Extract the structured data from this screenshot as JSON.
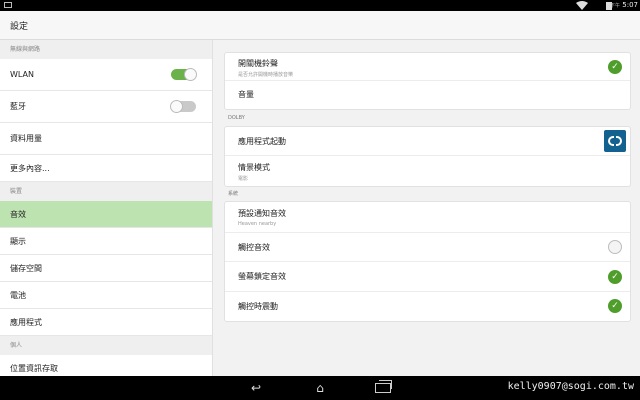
{
  "status_bar": {
    "ampm": "下午",
    "time": "5:07"
  },
  "app_title": "設定",
  "sidebar": {
    "sections": [
      {
        "header": "無線與網路",
        "items": [
          {
            "label": "WLAN",
            "toggle": "on"
          },
          {
            "label": "藍牙",
            "toggle": "off"
          },
          {
            "label": "資料用量"
          },
          {
            "label": "更多內容..."
          }
        ]
      },
      {
        "header": "裝置",
        "items": [
          {
            "label": "音效",
            "selected": true
          },
          {
            "label": "顯示"
          },
          {
            "label": "儲存空間"
          },
          {
            "label": "電池"
          },
          {
            "label": "應用程式"
          }
        ]
      },
      {
        "header": "個人",
        "items": [
          {
            "label": "位置資訊存取"
          }
        ]
      }
    ]
  },
  "sound": {
    "card1": [
      {
        "label": "開關機鈴聲",
        "sub": "是否允許開機時播放音樂",
        "control": "check"
      },
      {
        "label": "音量"
      }
    ],
    "dolby_header": "DOLBY",
    "card2": [
      {
        "label": "應用程式起動",
        "control": "dolby-icon"
      },
      {
        "label": "情景模式",
        "sub": "電影"
      }
    ],
    "system_header": "系統",
    "card3": [
      {
        "label": "預設通知音效",
        "sub": "Heaven nearby"
      },
      {
        "label": "觸控音效",
        "control": "empty"
      },
      {
        "label": "螢幕鎖定音效",
        "control": "check"
      },
      {
        "label": "觸控時震動",
        "control": "check"
      }
    ]
  },
  "navbar": {
    "back": "↩",
    "home": "⌂"
  },
  "watermark": "kelly0907@sogi.com.tw",
  "colors": {
    "accent_green": "#4f9e2c",
    "selected_bg": "#bde3b0",
    "dolby_blue": "#12618f"
  }
}
